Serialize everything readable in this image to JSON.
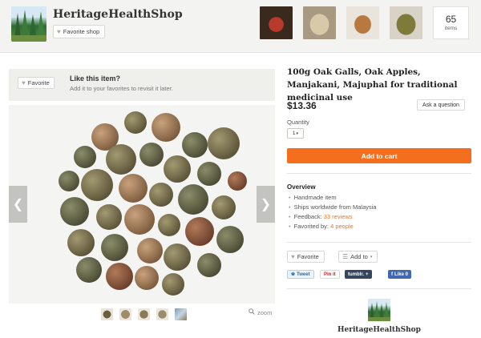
{
  "shop": {
    "name": "HeritageHealthShop",
    "favorite_shop_label": "Favorite shop",
    "items_count": "65",
    "items_label": "items"
  },
  "like_bar": {
    "favorite_label": "Favorite",
    "title": "Like this item?",
    "subtitle": "Add it to your favorites to revisit it later."
  },
  "gallery": {
    "zoom_label": "zoom"
  },
  "listing": {
    "title": "100g Oak Galls, Oak Apples, Manjakani, Majuphal for traditional medicinal use",
    "price": "$13.36",
    "ask_label": "Ask a question",
    "quantity_label": "Quantity",
    "quantity_value": "1",
    "add_to_cart_label": "Add to cart"
  },
  "overview": {
    "title": "Overview",
    "items": [
      {
        "text": "Handmade item"
      },
      {
        "text": "Ships worldwide from Malaysia"
      },
      {
        "text": "Feedback: ",
        "link": "33 reviews"
      },
      {
        "text": "Favorited by: ",
        "link": "4 people"
      }
    ]
  },
  "actions": {
    "favorite_label": "Favorite",
    "add_to_label": "Add to"
  },
  "social": {
    "tweet": "Tweet",
    "pin": "Pin it",
    "tumblr": "tumblr.",
    "fb_like": "Like 0"
  },
  "colors": {
    "accent_orange": "#f46f1d",
    "link_orange": "#e8772e"
  }
}
